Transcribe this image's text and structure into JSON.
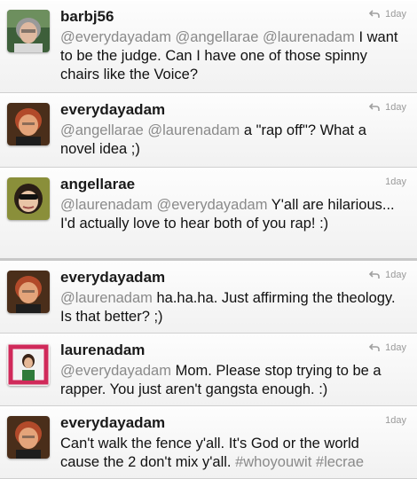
{
  "colors": {
    "mention": "#8a8a8a",
    "text": "#111111",
    "meta": "#9a9a9a"
  },
  "tweets": [
    {
      "handle": "barbj56",
      "time": "1day",
      "has_reply_icon": true,
      "avatar_icon": "avatar-barbj56",
      "body": [
        {
          "type": "mention",
          "text": "@everydayadam @angellarae @laurenadam"
        },
        {
          "type": "text",
          "text": " I want to be the judge.  Can I have one of those spinny chairs like the Voice?"
        }
      ]
    },
    {
      "handle": "everydayadam",
      "time": "1day",
      "has_reply_icon": true,
      "avatar_icon": "avatar-everydayadam",
      "body": [
        {
          "type": "mention",
          "text": "@angellarae @laurenadam"
        },
        {
          "type": "text",
          "text": " a \"rap off\"? What a novel idea ;)"
        }
      ]
    },
    {
      "handle": "angellarae",
      "time": "1day",
      "has_reply_icon": false,
      "avatar_icon": "avatar-angellarae",
      "body": [
        {
          "type": "mention",
          "text": "@laurenadam @everydayadam"
        },
        {
          "type": "text",
          "text": " Y'all are hilarious... I'd actually love to hear both of you rap! :)"
        }
      ]
    },
    {
      "handle": "everydayadam",
      "time": "1day",
      "has_reply_icon": true,
      "avatar_icon": "avatar-everydayadam",
      "body": [
        {
          "type": "mention",
          "text": "@laurenadam"
        },
        {
          "type": "text",
          "text": " ha.ha.ha.  Just affirming the theology.  Is that better? ;)"
        }
      ]
    },
    {
      "handle": "laurenadam",
      "time": "1day",
      "has_reply_icon": true,
      "avatar_icon": "avatar-laurenadam",
      "body": [
        {
          "type": "mention",
          "text": "@everydayadam"
        },
        {
          "type": "text",
          "text": " Mom. Please stop trying to be a rapper. You just aren't gangsta enough. :)"
        }
      ]
    },
    {
      "handle": "everydayadam",
      "time": "1day",
      "has_reply_icon": false,
      "avatar_icon": "avatar-everydayadam",
      "body": [
        {
          "type": "text",
          "text": "Can't walk the fence y'all. It's God or the world cause the 2 don't mix y'all. "
        },
        {
          "type": "hashtag",
          "text": "#whoyouwit"
        },
        {
          "type": "text",
          "text": " "
        },
        {
          "type": "hashtag",
          "text": "#lecrae"
        }
      ]
    }
  ]
}
